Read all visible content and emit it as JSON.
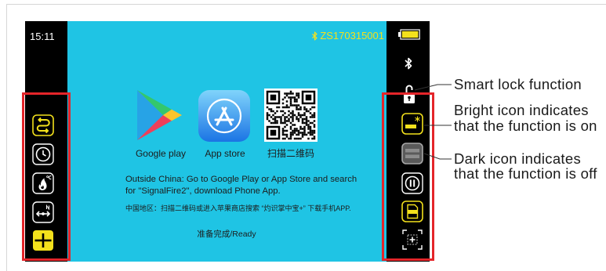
{
  "status_bar": {
    "time": "15:11",
    "device_id": "ZS170315001",
    "id_icon": "bluetooth-icon"
  },
  "left_toolbar": [
    {
      "icon": "repeat-icon",
      "color": "#f3e11c"
    },
    {
      "icon": "timer-icon",
      "color": "#ffffff"
    },
    {
      "icon": "heater-temperature-icon",
      "color": "#ffffff"
    },
    {
      "icon": "alignment-arrows-icon",
      "color": "#ffffff"
    },
    {
      "icon": "layout-icon",
      "color": "#f3e11c"
    }
  ],
  "right_toolbar": {
    "status_icons": [
      "battery-icon",
      "bluetooth-icon",
      "lock-icon"
    ],
    "buttons": [
      {
        "icon": "display-bar-icon",
        "color": "#f3e11c"
      },
      {
        "icon": "display-bar-icon",
        "color": "#5a5a5a"
      },
      {
        "icon": "pause-icon",
        "color": "#ffffff"
      },
      {
        "icon": "document-icon",
        "color": "#f3e11c"
      },
      {
        "icon": "focus-icon",
        "color": "#ffffff"
      }
    ]
  },
  "apps": [
    {
      "icon": "google-play-icon",
      "label": "Google play"
    },
    {
      "icon": "app-store-icon",
      "label": "App store"
    },
    {
      "icon": "qr-code-icon",
      "label": "扫描二维码"
    }
  ],
  "instructions": {
    "en_lines": [
      "Outside China: Go to Google Play or App Store and search",
      "for \"SignalFire2\", download Phone App."
    ],
    "cn": "中国地区：扫描二维码或进入苹果商店搜索 “灼识掌中宝+” 下载手机APP."
  },
  "status": "准备完成/Ready",
  "annotations": {
    "smart_lock": "Smart lock function",
    "bright_icon": [
      "Bright icon indicates",
      "that the function is on"
    ],
    "dark_icon": [
      "Dark icon indicates",
      "that the function is off"
    ]
  },
  "colors": {
    "screen_background": "#1fc4e4",
    "accent_yellow": "#f3e11c",
    "highlight_red": "#e4252a",
    "frame": "#000000"
  }
}
